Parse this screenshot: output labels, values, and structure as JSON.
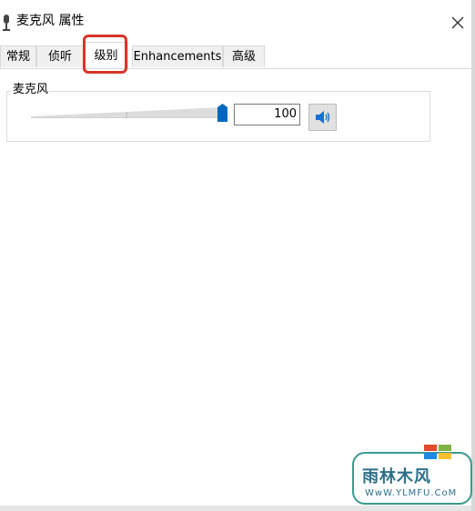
{
  "window": {
    "title": "麦克风 属性",
    "close_glyph": "✕"
  },
  "tabs": [
    {
      "label": "常规"
    },
    {
      "label": "侦听"
    },
    {
      "label": "级别"
    },
    {
      "label": "Enhancements"
    },
    {
      "label": "高级"
    }
  ],
  "active_tab": "级别",
  "levels": {
    "group_label": "麦克风",
    "value": "100",
    "level_percent": 100
  },
  "watermark": {
    "main_text": "雨林木风",
    "sub_text": "WwW.YLMFU.CoM"
  },
  "colors": {
    "highlight": "#d8342b",
    "slider_thumb": "#0067c0",
    "speaker_blue": "#1a6fd0",
    "watermark_border": "#3b9a8c"
  },
  "icons": {
    "title_icon": "microphone-icon",
    "speaker": "speaker-icon",
    "close": "close-icon"
  }
}
